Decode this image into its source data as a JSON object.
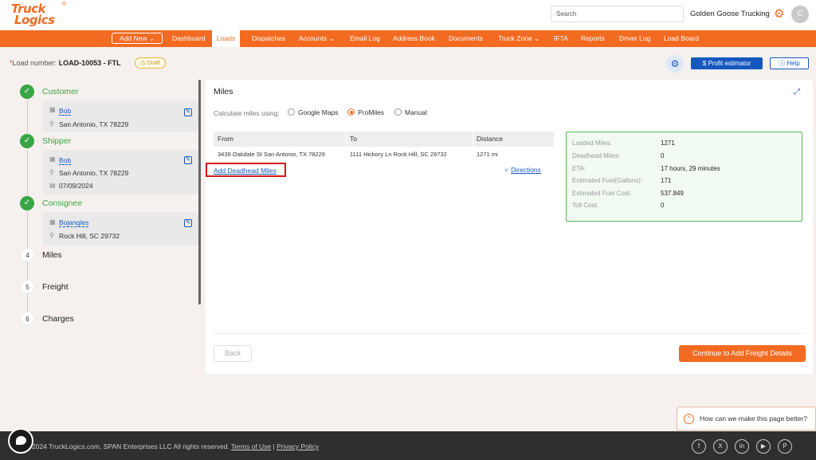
{
  "header": {
    "logo_line1": "Truck",
    "logo_line2": "Logics",
    "logo_reg": "®",
    "search_placeholder": "Search",
    "company": "Golden Goose Trucking",
    "avatar_initial": "C"
  },
  "nav": {
    "add_new": "Add New ⌄",
    "items": [
      "Dashboard",
      "Loads",
      "Dispatches",
      "Accounts ⌄",
      "Email Log",
      "Address Book",
      "Documents",
      "Truck Zone ⌄",
      "IFTA",
      "Reports",
      "Driver Log",
      "Load Board"
    ],
    "active": "Loads"
  },
  "load": {
    "label": "Load number:",
    "number": "LOAD-10053 - FTL",
    "status": "Draft",
    "profit_estimator": "Profit estimator",
    "help": "Help"
  },
  "steps": {
    "customer": {
      "title": "Customer",
      "name": "Bob",
      "address": "San Antonio, TX 78229"
    },
    "shipper": {
      "title": "Shipper",
      "name": "Bob",
      "address": "San Antonio, TX 78229",
      "date": "07/09/2024"
    },
    "consignee": {
      "title": "Consignee",
      "name": "Bojangles",
      "address": "Rock Hill, SC 29732"
    },
    "miles": {
      "num": "4",
      "title": "Miles"
    },
    "freight": {
      "num": "5",
      "title": "Freight"
    },
    "charges": {
      "num": "6",
      "title": "Charges"
    }
  },
  "miles": {
    "title": "Miles",
    "calc_label": "Calculate miles using:",
    "options": [
      "Google Maps",
      "ProMiles",
      "Manual"
    ],
    "selected": "ProMiles",
    "table": {
      "headers": [
        "From",
        "To",
        "Distance"
      ],
      "row": {
        "from": "3439 Oakdale St San Antonio, TX 78229",
        "to": "1111 Hickory Ln Rock Hill, SC 29732",
        "distance": "1271 mi"
      }
    },
    "add_deadhead": "Add Deadhead Miles",
    "directions": "Directions",
    "summary": [
      {
        "label": "Loaded Miles:",
        "value": "1271"
      },
      {
        "label": "Deadhead Miles:",
        "value": "0"
      },
      {
        "label": "ETA:",
        "value": "17 hours, 29 minutes"
      },
      {
        "label": "Estimated Fuel(Gallons):",
        "value": "171"
      },
      {
        "label": "Estimated Fuel Cost:",
        "value": "537.849"
      },
      {
        "label": "Toll Cost:",
        "value": "0"
      }
    ],
    "back": "Back",
    "continue": "Continue to Add Freight Details"
  },
  "feedback": "How can we make this page better?",
  "footer": {
    "copyright": "2024 TruckLogics.com, SPAN Enterprises LLC All rights reserved.",
    "terms": "Terms of Use",
    "divider": "|",
    "privacy": "Privacy Policy",
    "social": [
      "facebook-icon",
      "x-icon",
      "linkedin-icon",
      "youtube-icon",
      "pinterest-icon"
    ]
  },
  "colors": {
    "brand": "#f26b21",
    "primary": "#1558c0",
    "success": "#3aa544",
    "highlight": "#d6171a"
  }
}
